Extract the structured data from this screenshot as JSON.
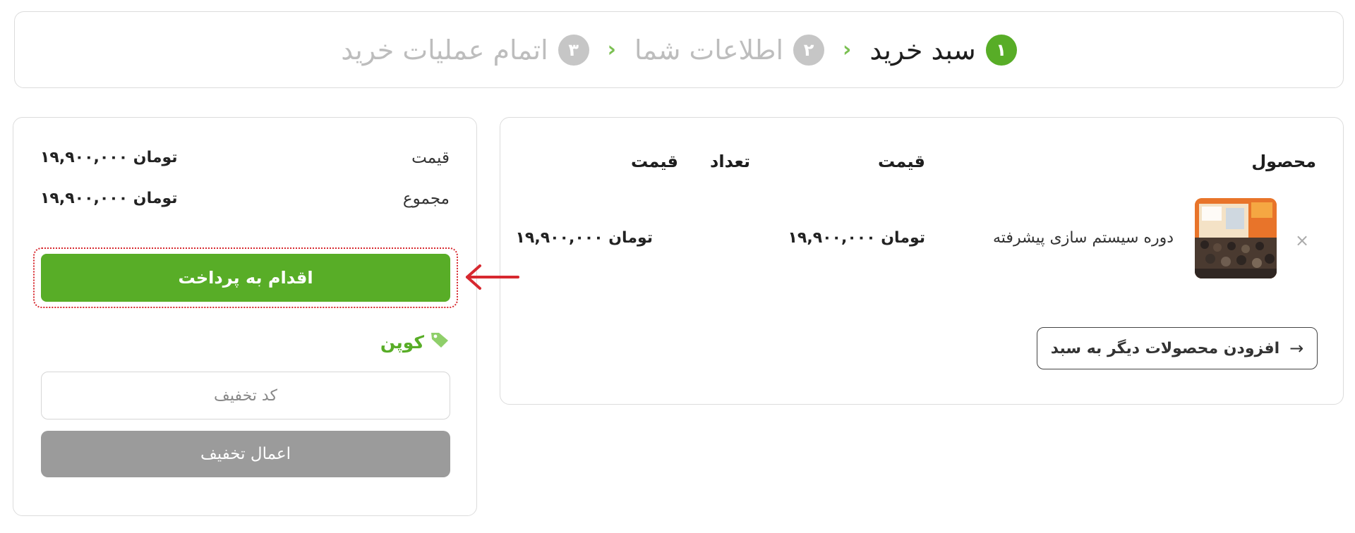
{
  "steps": {
    "step1": {
      "num": "۱",
      "label": "سبد خرید"
    },
    "step2": {
      "num": "۲",
      "label": "اطلاعات شما"
    },
    "step3": {
      "num": "۳",
      "label": "اتمام عملیات خرید"
    },
    "separator": "›"
  },
  "cart": {
    "headers": {
      "product": "محصول",
      "price": "قیمت",
      "quantity": "تعداد",
      "subtotal": "قیمت"
    },
    "item": {
      "name": "دوره سیستم سازی پیشرفته",
      "price": "۱۹,۹۰۰,۰۰۰ تومان",
      "subtotal": "۱۹,۹۰۰,۰۰۰ تومان",
      "remove": "×"
    },
    "add_more": {
      "label": "افزودن محصولات دیگر به سبد",
      "arrow": "→"
    }
  },
  "summary": {
    "price_label": "قیمت",
    "price_value": "۱۹,۹۰۰,۰۰۰ تومان",
    "total_label": "مجموع",
    "total_value": "۱۹,۹۰۰,۰۰۰ تومان",
    "checkout_label": "اقدام به پرداخت"
  },
  "coupon": {
    "title": "کوپن",
    "placeholder": "کد تخفیف",
    "apply_label": "اعمال تخفیف"
  },
  "colors": {
    "accent": "#58ad27",
    "inactive": "#c6c6c6",
    "annotation": "#d7282f",
    "apply_button": "#9b9b9b"
  },
  "icons": {
    "coupon": "tag-icon",
    "remove": "close-icon",
    "annotation": "arrow-left-icon"
  }
}
